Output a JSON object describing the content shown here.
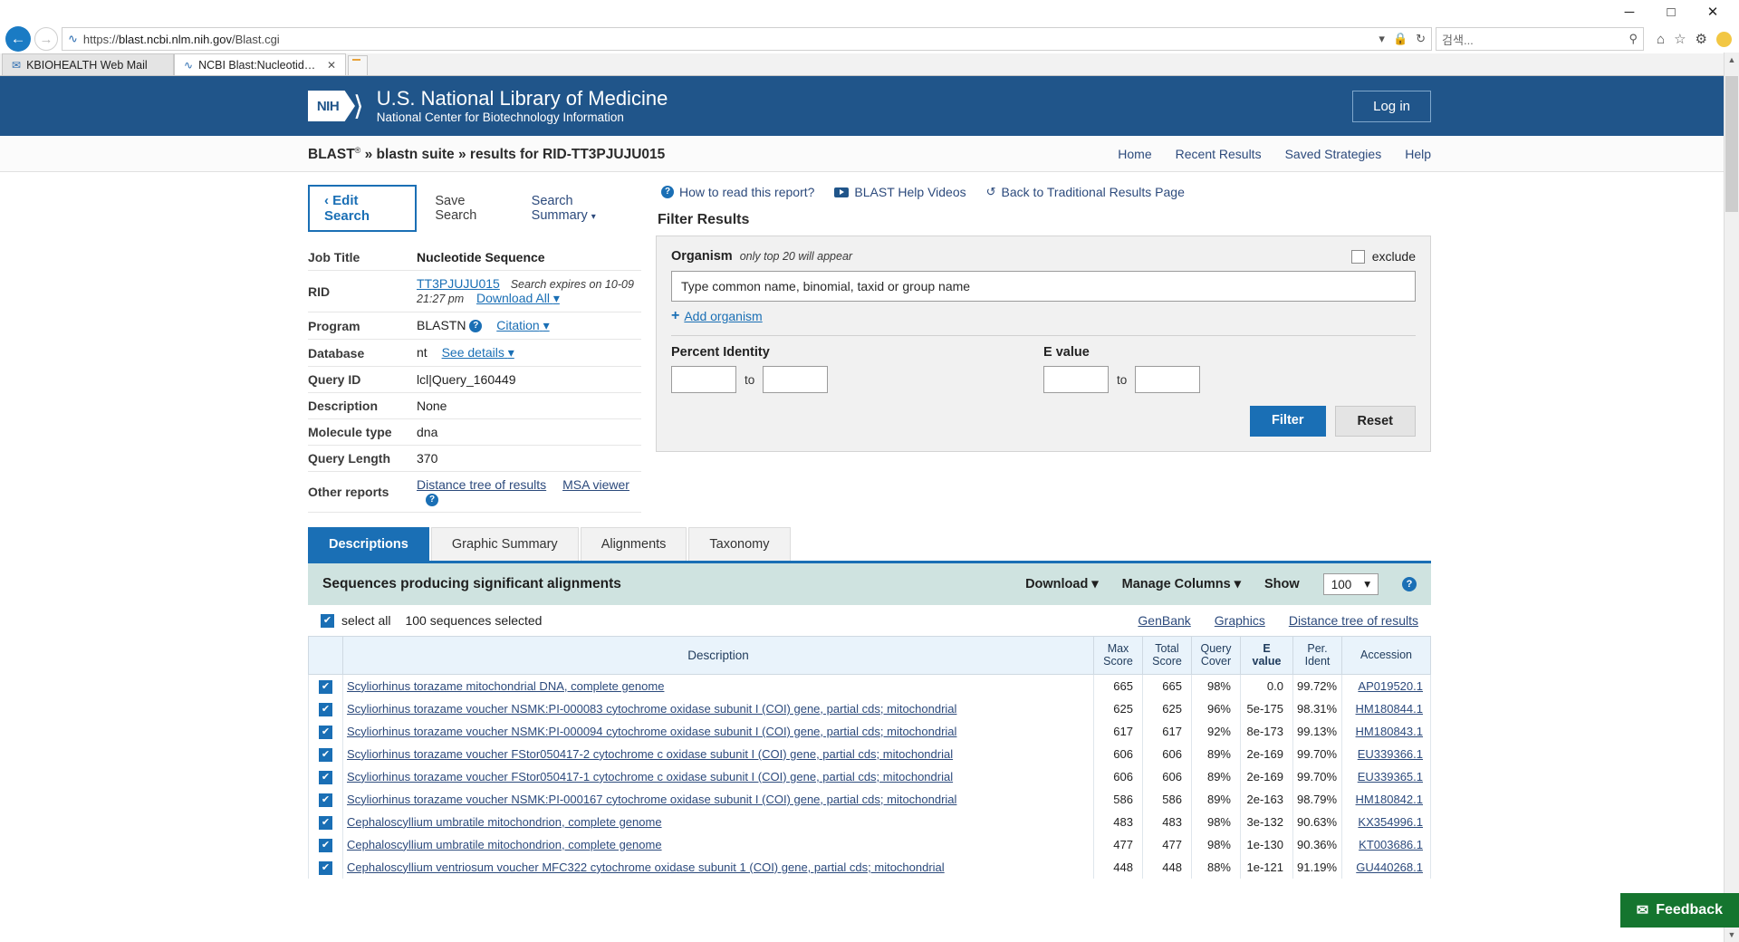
{
  "browser": {
    "window_controls": {
      "minimize": "─",
      "maximize": "□",
      "close": "✕"
    },
    "back_icon": "←",
    "forward_icon": "→",
    "url_prefix": "https://",
    "url_host": "blast.ncbi.nlm.nih.gov",
    "url_path": "/Blast.cgi",
    "url_dropdown_icon": "▾",
    "lock_icon": "🔒",
    "refresh_icon": "↻",
    "search_placeholder": "검색...",
    "search_icon": "⚲",
    "home_icon": "⌂",
    "favorites_icon": "☆",
    "tools_icon": "⚙",
    "tabs": [
      {
        "label": "KBIOHEALTH Web Mail",
        "active": false,
        "closable": false
      },
      {
        "label": "NCBI Blast:Nucleotide Seq...",
        "active": true,
        "closable": true,
        "close_icon": "✕"
      }
    ]
  },
  "nih_header": {
    "logo_text": "NIH",
    "title": "U.S. National Library of Medicine",
    "subtitle": "National Center for Biotechnology Information",
    "login_label": "Log in"
  },
  "breadcrumb": {
    "text": "BLAST » blastn suite » results for RID-TT3PJUJU015",
    "superscript": "®",
    "nav": [
      "Home",
      "Recent Results",
      "Saved Strategies",
      "Help"
    ]
  },
  "actions": {
    "edit_search": "‹ Edit Search",
    "save_search": "Save Search",
    "search_summary": "Search Summary",
    "caret": "⌄"
  },
  "job_info": {
    "rows": [
      {
        "key": "Job Title",
        "value": "Nucleotide Sequence",
        "bold": true
      },
      {
        "key": "RID",
        "value": "TT3PJUJU015"
      },
      {
        "key": "Program",
        "value": "BLASTN"
      },
      {
        "key": "Database",
        "value": "nt"
      },
      {
        "key": "Query ID",
        "value": "lcl|Query_160449"
      },
      {
        "key": "Description",
        "value": "None"
      },
      {
        "key": "Molecule type",
        "value": "dna"
      },
      {
        "key": "Query Length",
        "value": "370"
      },
      {
        "key": "Other reports",
        "value": ""
      }
    ],
    "rid_expires": "Search expires on 10-09 21:27 pm",
    "download_all": "Download All",
    "citation": "Citation",
    "see_details": "See details",
    "distance_tree": "Distance tree of results",
    "msa_viewer": "MSA viewer",
    "help_glyph": "?"
  },
  "help_links": {
    "how_to_read": "How to read this report?",
    "help_videos": "BLAST Help Videos",
    "back_traditional": "Back to Traditional Results Page",
    "back_icon": "↺"
  },
  "filter": {
    "title": "Filter Results",
    "organism_label": "Organism",
    "organism_note": "only top 20 will appear",
    "exclude_label": "exclude",
    "organism_placeholder": "Type common  name, binomial, taxid or group  name",
    "add_organism": "Add organism",
    "add_icon": "+",
    "percent_identity_label": "Percent Identity",
    "evalue_label": "E value",
    "to_label": "to",
    "percent_from": "",
    "percent_to": "",
    "evalue_from": "",
    "evalue_to": "",
    "filter_button": "Filter",
    "reset_button": "Reset"
  },
  "result_tabs": [
    {
      "label": "Descriptions",
      "active": true
    },
    {
      "label": "Graphic Summary",
      "active": false
    },
    {
      "label": "Alignments",
      "active": false
    },
    {
      "label": "Taxonomy",
      "active": false
    }
  ],
  "results_header": {
    "title": "Sequences producing significant alignments",
    "download": "Download",
    "manage_columns": "Manage Columns",
    "show_label": "Show",
    "show_value": "100",
    "caret": "⌄",
    "help_glyph": "?"
  },
  "selection_bar": {
    "select_all_label": "select all",
    "selected_count": "100 sequences selected",
    "check_glyph": "✔",
    "links": [
      "GenBank",
      "Graphics",
      "Distance tree of results"
    ]
  },
  "table": {
    "columns": [
      "Description",
      "Max\nScore",
      "Total\nScore",
      "Query\nCover",
      "E\nvalue",
      "Per.\nIdent",
      "Accession"
    ],
    "column_headers": {
      "description": "Description",
      "max_score_1": "Max",
      "max_score_2": "Score",
      "total_score_1": "Total",
      "total_score_2": "Score",
      "query_cover_1": "Query",
      "query_cover_2": "Cover",
      "evalue_1": "E",
      "evalue_2": "value",
      "per_ident_1": "Per.",
      "per_ident_2": "Ident",
      "accession": "Accession"
    },
    "rows": [
      {
        "checked": true,
        "description": "Scyliorhinus torazame mitochondrial DNA, complete genome",
        "max_score": "665",
        "total_score": "665",
        "query_cover": "98%",
        "evalue": "0.0",
        "per_ident": "99.72%",
        "accession": "AP019520.1"
      },
      {
        "checked": true,
        "description": "Scyliorhinus torazame voucher NSMK:PI-000083 cytochrome oxidase subunit I (COI) gene, partial cds; mitochondrial",
        "max_score": "625",
        "total_score": "625",
        "query_cover": "96%",
        "evalue": "5e-175",
        "per_ident": "98.31%",
        "accession": "HM180844.1"
      },
      {
        "checked": true,
        "description": "Scyliorhinus torazame voucher NSMK:PI-000094 cytochrome oxidase subunit I (COI) gene, partial cds; mitochondrial",
        "max_score": "617",
        "total_score": "617",
        "query_cover": "92%",
        "evalue": "8e-173",
        "per_ident": "99.13%",
        "accession": "HM180843.1"
      },
      {
        "checked": true,
        "description": "Scyliorhinus torazame voucher FStor050417-2 cytochrome c oxidase subunit I (COI) gene, partial cds; mitochondrial",
        "max_score": "606",
        "total_score": "606",
        "query_cover": "89%",
        "evalue": "2e-169",
        "per_ident": "99.70%",
        "accession": "EU339366.1"
      },
      {
        "checked": true,
        "description": "Scyliorhinus torazame voucher FStor050417-1 cytochrome c oxidase subunit I (COI) gene, partial cds; mitochondrial",
        "max_score": "606",
        "total_score": "606",
        "query_cover": "89%",
        "evalue": "2e-169",
        "per_ident": "99.70%",
        "accession": "EU339365.1"
      },
      {
        "checked": true,
        "description": "Scyliorhinus torazame voucher NSMK:PI-000167 cytochrome oxidase subunit I (COI) gene, partial cds; mitochondrial",
        "max_score": "586",
        "total_score": "586",
        "query_cover": "89%",
        "evalue": "2e-163",
        "per_ident": "98.79%",
        "accession": "HM180842.1"
      },
      {
        "checked": true,
        "description": "Cephaloscyllium umbratile mitochondrion, complete genome",
        "max_score": "483",
        "total_score": "483",
        "query_cover": "98%",
        "evalue": "3e-132",
        "per_ident": "90.63%",
        "accession": "KX354996.1"
      },
      {
        "checked": true,
        "description": "Cephaloscyllium umbratile mitochondrion, complete genome",
        "max_score": "477",
        "total_score": "477",
        "query_cover": "98%",
        "evalue": "1e-130",
        "per_ident": "90.36%",
        "accession": "KT003686.1"
      },
      {
        "checked": true,
        "description": "Cephaloscyllium ventriosum voucher MFC322 cytochrome oxidase subunit 1 (COI) gene, partial cds; mitochondrial",
        "max_score": "448",
        "total_score": "448",
        "query_cover": "88%",
        "evalue": "1e-121",
        "per_ident": "91.19%",
        "accession": "GU440268.1"
      }
    ]
  },
  "feedback": {
    "label": "Feedback",
    "icon": "✉"
  },
  "colors": {
    "nih_blue": "#20558a",
    "link_blue": "#2c4a7c",
    "accent_blue": "#1a6fb5",
    "tab_active": "#1a6fb5",
    "seqbar_teal": "#cfe3e0",
    "feedback_green": "#15752f"
  }
}
